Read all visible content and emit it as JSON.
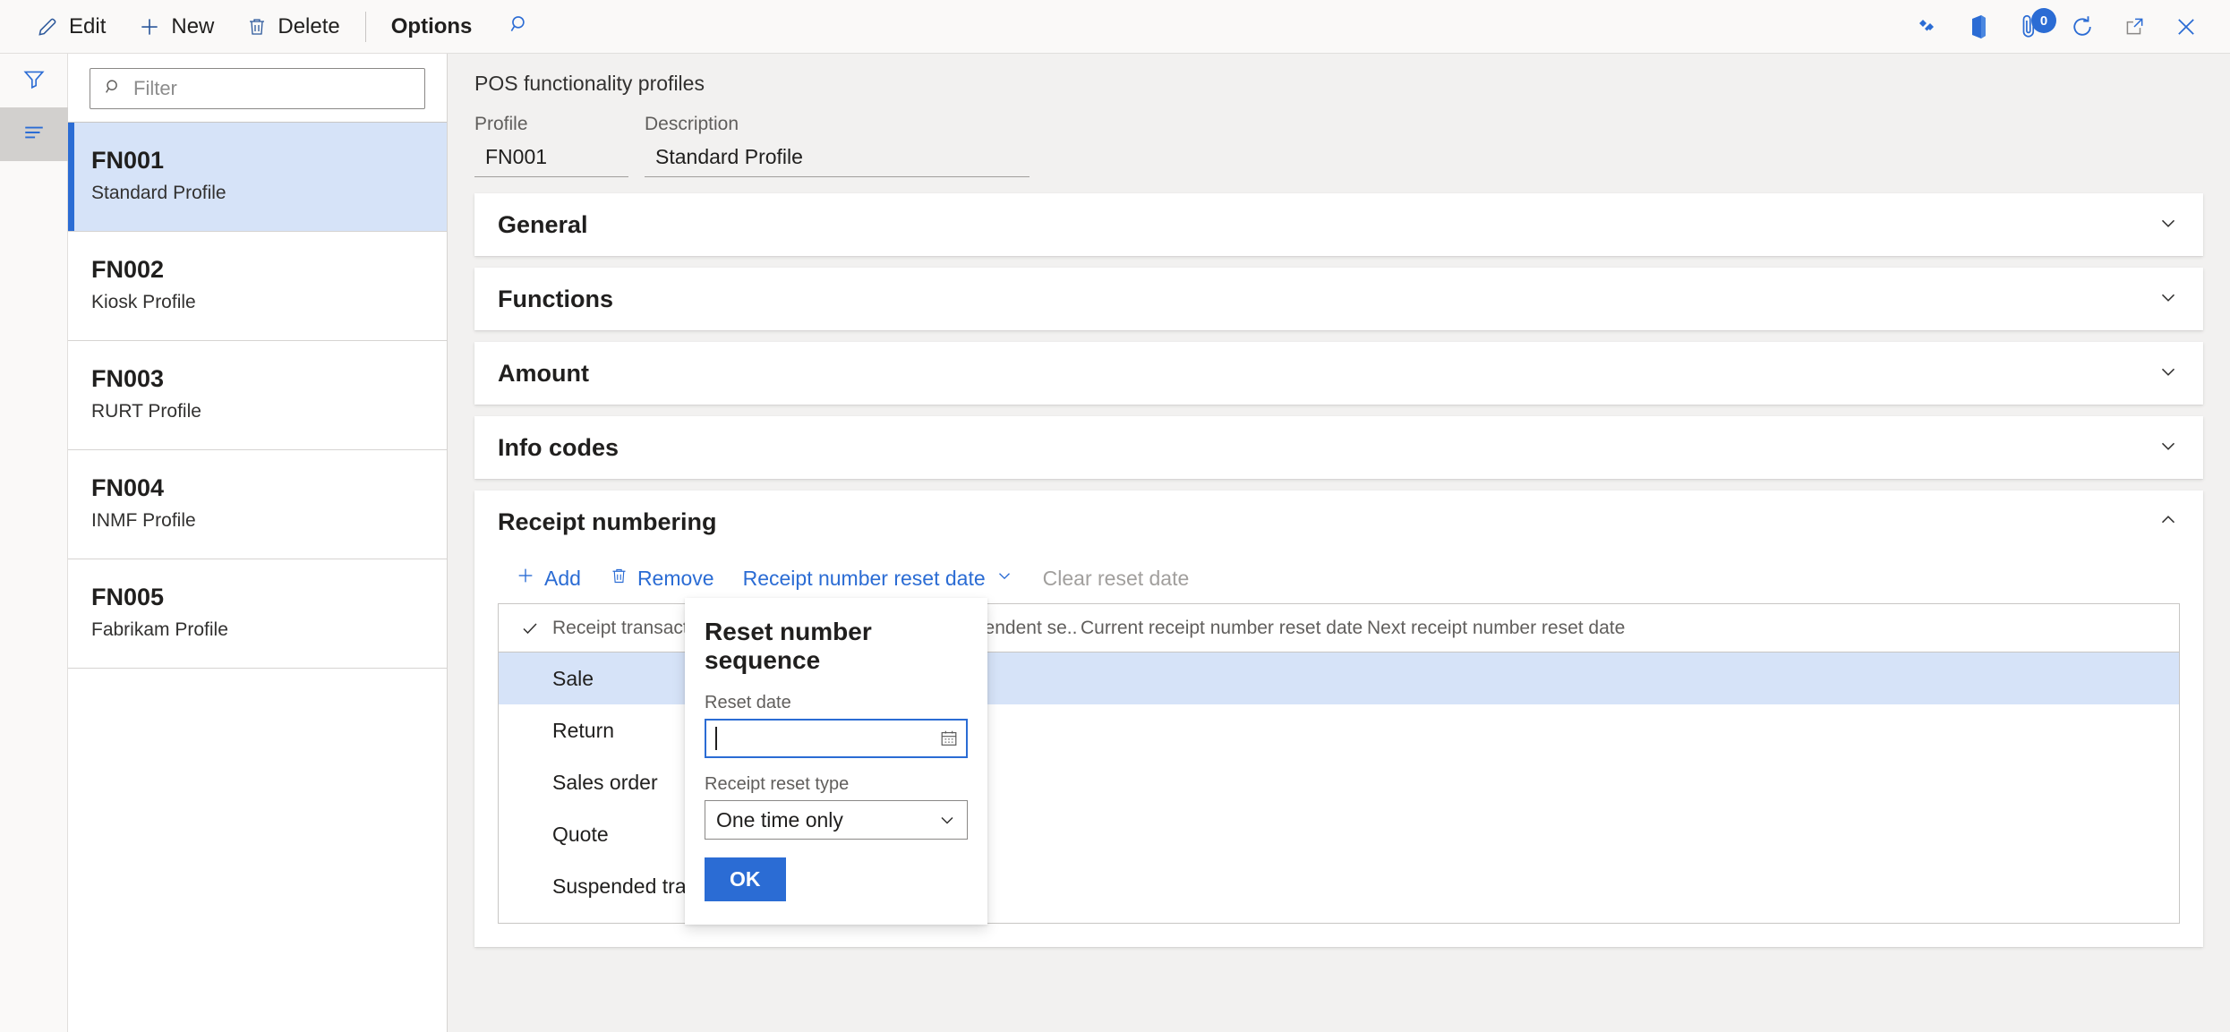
{
  "commandbar": {
    "buttons": [
      {
        "label": "Edit",
        "icon": "pencil-icon"
      },
      {
        "label": "New",
        "icon": "plus-icon"
      },
      {
        "label": "Delete",
        "icon": "trash-icon"
      }
    ],
    "options_label": "Options",
    "search_icon": "search-icon",
    "right_icons": [
      {
        "name": "dynamics-logo-icon"
      },
      {
        "name": "office-logo-icon"
      },
      {
        "name": "attachment-icon",
        "badge": "0"
      },
      {
        "name": "refresh-icon"
      },
      {
        "name": "open-in-new-window-icon"
      },
      {
        "name": "close-icon"
      }
    ]
  },
  "rail": {
    "filter_icon": "funnel-icon",
    "list_icon": "list-lines-icon"
  },
  "listpane": {
    "filter_placeholder": "Filter",
    "filter_value": "",
    "items": [
      {
        "code": "FN001",
        "desc": "Standard Profile",
        "selected": true
      },
      {
        "code": "FN002",
        "desc": "Kiosk Profile",
        "selected": false
      },
      {
        "code": "FN003",
        "desc": "RURT Profile",
        "selected": false
      },
      {
        "code": "FN004",
        "desc": "INMF Profile",
        "selected": false
      },
      {
        "code": "FN005",
        "desc": "Fabrikam Profile",
        "selected": false
      }
    ]
  },
  "form": {
    "title": "POS functionality profiles",
    "profile_label": "Profile",
    "profile_value": "FN001",
    "description_label": "Description",
    "description_value": "Standard Profile"
  },
  "sections": [
    {
      "title": "General",
      "expanded": false
    },
    {
      "title": "Functions",
      "expanded": false
    },
    {
      "title": "Amount",
      "expanded": false
    },
    {
      "title": "Info codes",
      "expanded": false
    },
    {
      "title": "Receipt numbering",
      "expanded": true
    }
  ],
  "grid_toolbar": {
    "add_label": "Add",
    "remove_label": "Remove",
    "reset_date_label": "Receipt number reset date",
    "clear_reset_label": "Clear reset date"
  },
  "grid": {
    "columns": [
      "Receipt transaction t...",
      "Independent se...",
      "Current receipt number reset date",
      "Next receipt number reset date"
    ],
    "rows": [
      {
        "type": "Sale",
        "independent": "✓",
        "current": "",
        "next": "",
        "selected": true
      },
      {
        "type": "Return",
        "independent": "✓",
        "current": "",
        "next": "",
        "selected": false
      },
      {
        "type": "Sales order",
        "independent": "✓",
        "current": "",
        "next": "",
        "selected": false
      },
      {
        "type": "Quote",
        "independent": "✓",
        "current": "",
        "next": "",
        "selected": false
      },
      {
        "type": "Suspended transaction",
        "independent": "✓",
        "current": "",
        "next": "",
        "selected": false
      }
    ]
  },
  "popup": {
    "title": "Reset number sequence",
    "reset_date_label": "Reset date",
    "reset_date_value": "",
    "calendar_icon": "calendar-icon",
    "reset_type_label": "Receipt reset type",
    "reset_type_value": "One time only",
    "ok_label": "OK"
  },
  "colors": {
    "accent": "#2b6cd4",
    "selection_bg": "#d6e3f8",
    "link": "#2b6cd4",
    "page_bg": "#f2f1f0"
  }
}
